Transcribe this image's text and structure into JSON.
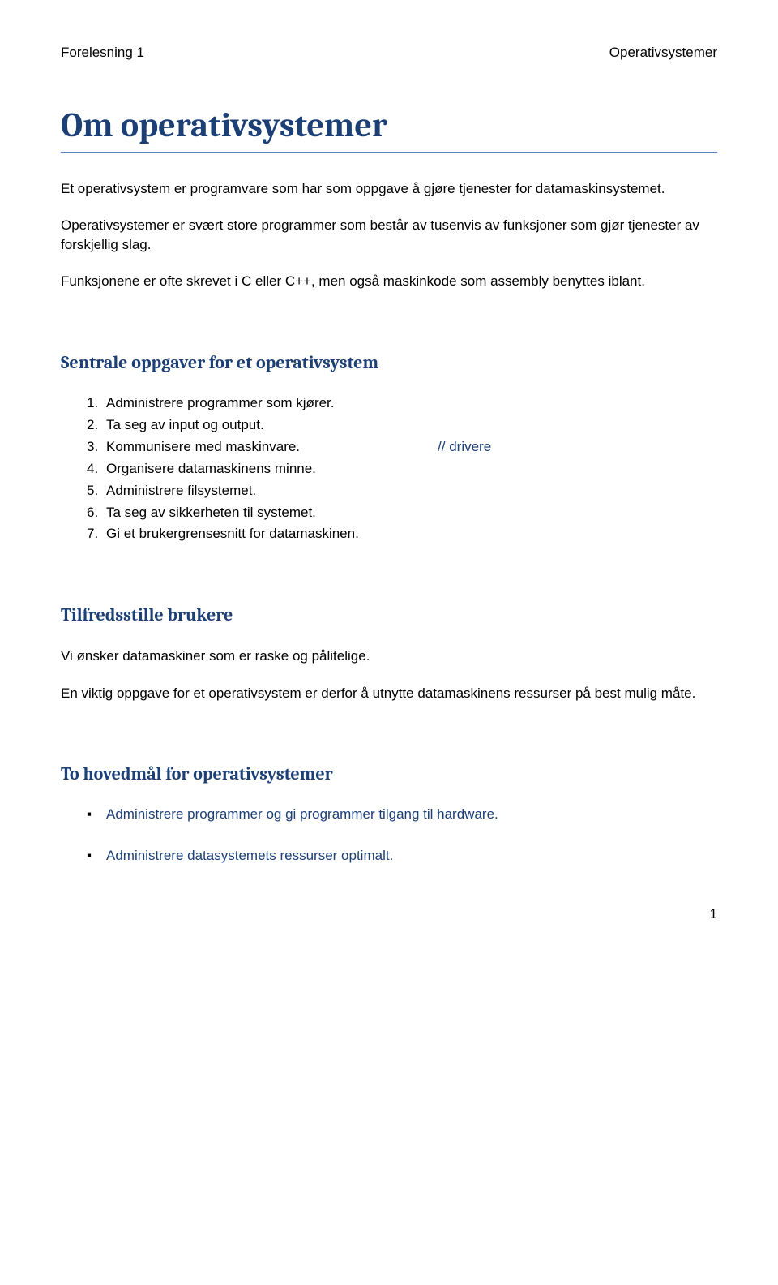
{
  "header": {
    "left": "Forelesning 1",
    "right": "Operativsystemer"
  },
  "title": "Om operativsystemer",
  "intro": {
    "p1": "Et operativsystem er programvare som har som oppgave å gjøre tjenester for datamaskinsystemet.",
    "p2": "Operativsystemer er svært store programmer som består av tusenvis av funksjoner som gjør tjenester av forskjellig slag.",
    "p3": "Funksjonene er ofte skrevet i C eller C++, men også maskinkode som assembly benyttes iblant."
  },
  "section1": {
    "heading": "Sentrale oppgaver for et operativsystem",
    "items": [
      {
        "n": "1.",
        "text": "Administrere programmer som kjører.",
        "comment": ""
      },
      {
        "n": "2.",
        "text": "Ta seg av input og output.",
        "comment": ""
      },
      {
        "n": "3.",
        "text": "Kommunisere med maskinvare.",
        "comment": "// drivere"
      },
      {
        "n": "4.",
        "text": "Organisere datamaskinens minne.",
        "comment": ""
      },
      {
        "n": "5.",
        "text": "Administrere filsystemet.",
        "comment": ""
      },
      {
        "n": "6.",
        "text": "Ta seg av sikkerheten til systemet.",
        "comment": ""
      },
      {
        "n": "7.",
        "text": "Gi et brukergrensesnitt for datamaskinen.",
        "comment": ""
      }
    ]
  },
  "section2": {
    "heading": "Tilfredsstille brukere",
    "p1": "Vi ønsker datamaskiner som er raske og pålitelige.",
    "p2": "En viktig oppgave for et operativsystem er derfor å utnytte datamaskinens ressurser på best mulig måte."
  },
  "section3": {
    "heading": "To hovedmål for operativsystemer",
    "bullets": [
      "Administrere programmer og gi programmer tilgang til hardware.",
      "Administrere datasystemets ressurser optimalt."
    ]
  },
  "pageNumber": "1"
}
